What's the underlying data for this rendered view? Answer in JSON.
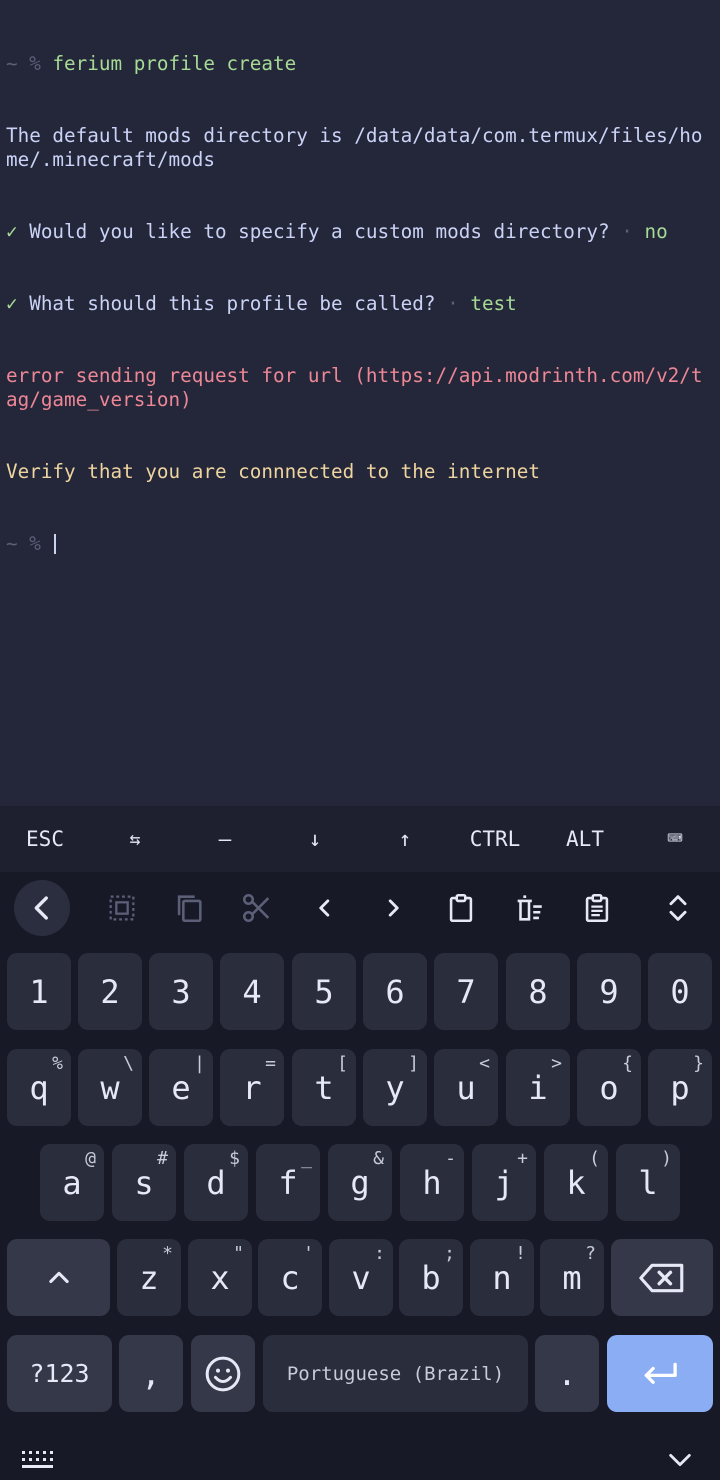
{
  "terminal": {
    "lines": [
      {
        "prompt": "~ % ",
        "text": "ferium profile create"
      },
      {
        "text": "The default mods directory is /data/data/com.termux/files/home/.minecraft/mods"
      },
      {
        "check": "✓ ",
        "question": "Would you like to specify a custom mods directory?",
        "arrow": " · ",
        "answer": "no"
      },
      {
        "check": "✓ ",
        "question": "What should this profile be called?",
        "arrow": " · ",
        "answer": "test"
      },
      {
        "error": "error sending request for url (https://api.modrinth.com/v2/tag/game_version)"
      },
      {
        "warn": "Verify that you are connnected to the internet"
      },
      {
        "prompt": "~ % "
      }
    ]
  },
  "extra_keys": [
    "ESC",
    "⇆",
    "—",
    "↓",
    "↑",
    "CTRL",
    "ALT",
    "⌨"
  ],
  "toolbar_icons": [
    "back-icon",
    "select-all-icon",
    "copy-icon",
    "cut-icon",
    "cursor-left-icon",
    "cursor-right-icon",
    "paste-icon",
    "clipboard-delete-icon",
    "clipboard-icon",
    "expand-icon"
  ],
  "keyboard": {
    "numbers": [
      "1",
      "2",
      "3",
      "4",
      "5",
      "6",
      "7",
      "8",
      "9",
      "0"
    ],
    "row1": [
      [
        "q",
        "%"
      ],
      [
        "w",
        "\\"
      ],
      [
        "e",
        "|"
      ],
      [
        "r",
        "="
      ],
      [
        "t",
        "["
      ],
      [
        "y",
        "]"
      ],
      [
        "u",
        "<"
      ],
      [
        "i",
        ">"
      ],
      [
        "o",
        "{"
      ],
      [
        "p",
        "}"
      ]
    ],
    "row2": [
      [
        "a",
        "@"
      ],
      [
        "s",
        "#"
      ],
      [
        "d",
        "$"
      ],
      [
        "f",
        "_"
      ],
      [
        "g",
        "&"
      ],
      [
        "h",
        "-"
      ],
      [
        "j",
        "+"
      ],
      [
        "k",
        "("
      ],
      [
        "l",
        ")"
      ]
    ],
    "row3": [
      [
        "z",
        "*"
      ],
      [
        "x",
        "\""
      ],
      [
        "c",
        "'"
      ],
      [
        "v",
        ":"
      ],
      [
        "b",
        ";"
      ],
      [
        "n",
        "!"
      ],
      [
        "m",
        "?"
      ]
    ],
    "symbols_label": "?123",
    "comma": ",",
    "space_label": "Portuguese (Brazil)",
    "period": "."
  },
  "colors": {
    "background": "#24273a",
    "accent": "#8aadf4",
    "enter_key": "#8aadf4"
  }
}
